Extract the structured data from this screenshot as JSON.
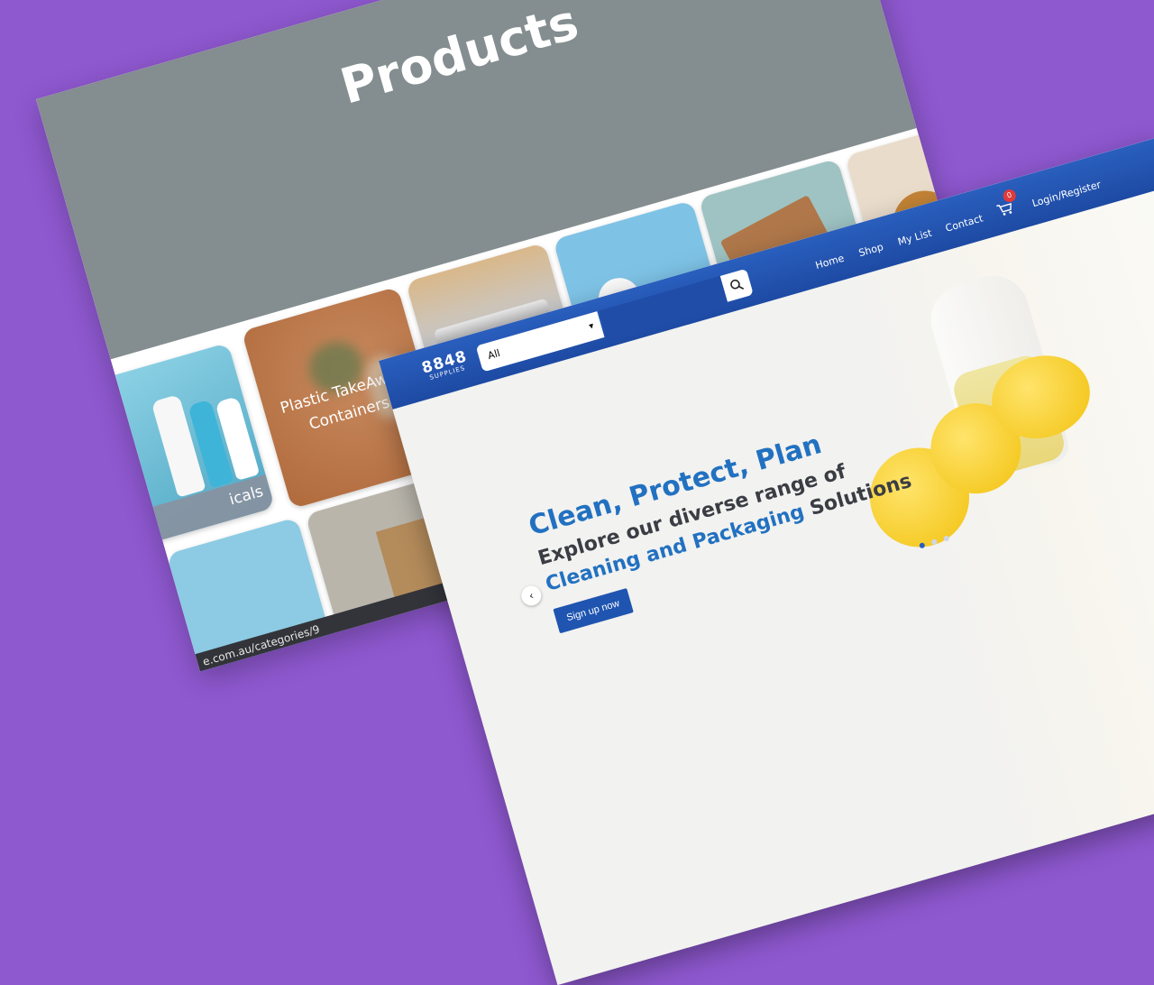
{
  "products_page": {
    "title": "Products",
    "tiles": [
      {
        "label": "icals"
      },
      {
        "label": "Plastic TakeAway Containers"
      }
    ],
    "status_url": "e.com.au/categories/9"
  },
  "home_page": {
    "logo_main": "8848",
    "logo_sub": "SUPPLIES",
    "search": {
      "category_value": "All",
      "placeholder": ""
    },
    "nav": [
      "Home",
      "Shop",
      "My List",
      "Contact"
    ],
    "cart_count": "0",
    "login_label": "Login/Register",
    "hero": {
      "headline": "Clean, Protect, Plan",
      "sub_line1": "Explore our diverse range of",
      "sub_line2_highlight": "Cleaning and Packaging",
      "sub_line2_rest": " Solutions",
      "cta": "Sign up now",
      "prev_arrow": "‹"
    },
    "colors": {
      "background": "#8e58cf",
      "header_blue": "#2a5fbe",
      "accent_blue": "#2271c1",
      "badge_red": "#e03a3a"
    }
  }
}
